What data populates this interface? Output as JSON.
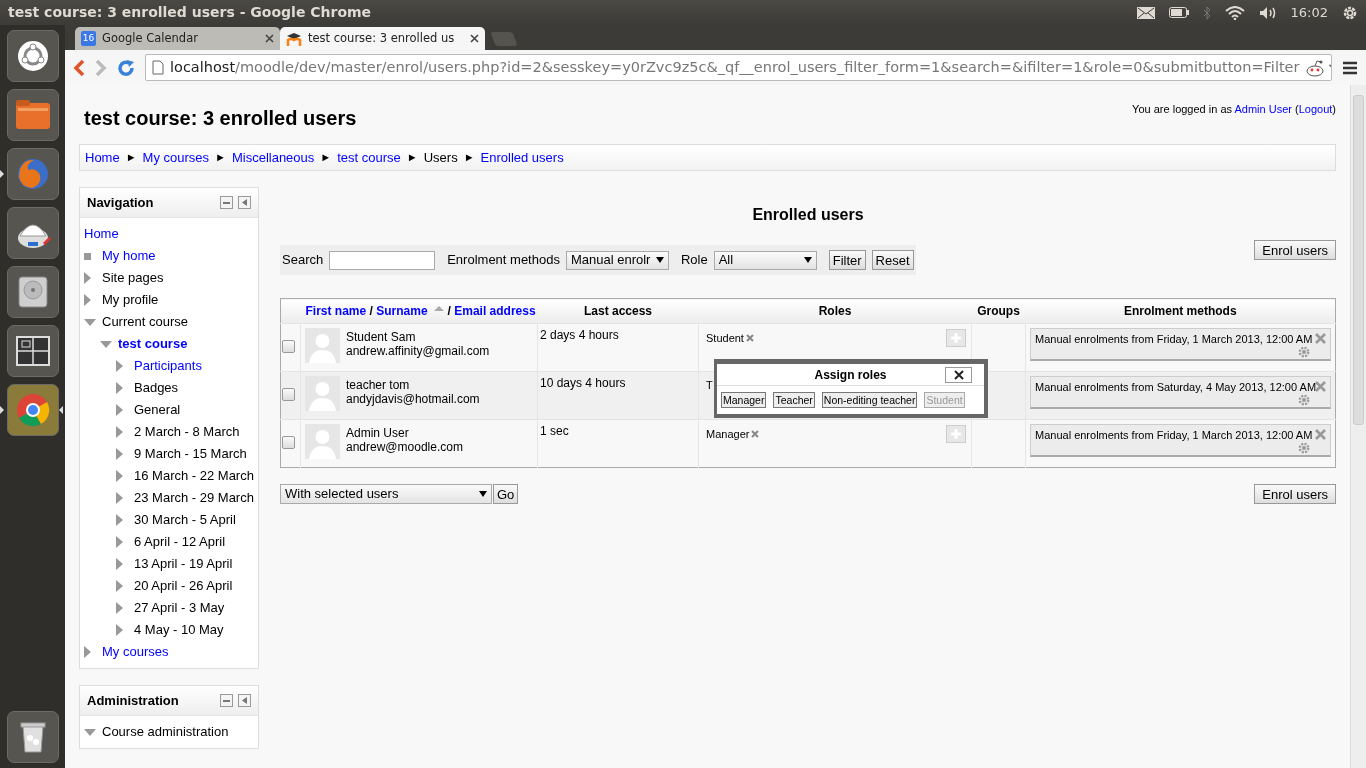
{
  "window": {
    "title": "test course: 3 enrolled users - Google Chrome"
  },
  "tray": {
    "clock": "16:02"
  },
  "launcher": [
    {
      "kind": "ubuntu",
      "running": false,
      "focused": false
    },
    {
      "kind": "files",
      "running": false,
      "focused": false
    },
    {
      "kind": "firefox",
      "running": true,
      "focused": false
    },
    {
      "kind": "app",
      "running": false,
      "focused": false
    },
    {
      "kind": "disk",
      "running": false,
      "focused": false
    },
    {
      "kind": "workspaces",
      "running": false,
      "focused": false
    },
    {
      "kind": "chrome",
      "running": true,
      "focused": true
    },
    {
      "kind": "trash",
      "running": false,
      "focused": false
    }
  ],
  "tabs": [
    {
      "title": "Google Calendar",
      "kind": "calendar",
      "icon_text": "16",
      "selected": false
    },
    {
      "title": "test course: 3 enrolled us",
      "kind": "moodle",
      "selected": true
    }
  ],
  "address": {
    "host": "localhost",
    "path": "/moodle/dev/master/enrol/users.php?id=2&sesskey=y0rZvc9z5c&_qf__enrol_users_filter_form=1&search=&ifilter=1&role=0&submitbutton=Filter"
  },
  "page": {
    "heading": "test course: 3 enrolled users",
    "login": {
      "before": "You are logged in as ",
      "user": "Admin User",
      "between": " (",
      "logout": "Logout",
      "after": ")"
    },
    "breadcrumb": [
      {
        "label": "Home",
        "link": true,
        "sep": "►"
      },
      {
        "label": "My courses",
        "link": true,
        "sep": "►"
      },
      {
        "label": "Miscellaneous",
        "link": true,
        "sep": "►"
      },
      {
        "label": "test course",
        "link": true,
        "sep": "►"
      },
      {
        "label": "Users",
        "link": false,
        "sep": "►"
      },
      {
        "label": "Enrolled users",
        "link": true
      }
    ]
  },
  "navigation": {
    "title": "Navigation",
    "items": [
      {
        "label": "Home",
        "kind": "plain",
        "link": true,
        "selected": false
      },
      {
        "label": "My home",
        "kind": "leaf",
        "link": true,
        "selected": false
      },
      {
        "label": "Site pages",
        "kind": "collapsed",
        "link": false,
        "selected": false
      },
      {
        "label": "My profile",
        "kind": "collapsed",
        "link": false,
        "selected": false
      },
      {
        "label": "Current course",
        "kind": "expanded",
        "link": false,
        "selected": false,
        "children": [
          {
            "label": "test course",
            "kind": "expanded",
            "link": true,
            "selected": true,
            "children": [
              {
                "label": "Participants",
                "kind": "collapsed",
                "link": true,
                "selected": false
              },
              {
                "label": "Badges",
                "kind": "collapsed",
                "link": false,
                "selected": false
              },
              {
                "label": "General",
                "kind": "collapsed",
                "link": false,
                "selected": false
              },
              {
                "label": "2 March - 8 March",
                "kind": "collapsed",
                "link": false,
                "selected": false
              },
              {
                "label": "9 March - 15 March",
                "kind": "collapsed",
                "link": false,
                "selected": false
              },
              {
                "label": "16 March - 22 March",
                "kind": "collapsed",
                "link": false,
                "selected": false
              },
              {
                "label": "23 March - 29 March",
                "kind": "collapsed",
                "link": false,
                "selected": false
              },
              {
                "label": "30 March - 5 April",
                "kind": "collapsed",
                "link": false,
                "selected": false
              },
              {
                "label": "6 April - 12 April",
                "kind": "collapsed",
                "link": false,
                "selected": false
              },
              {
                "label": "13 April - 19 April",
                "kind": "collapsed",
                "link": false,
                "selected": false
              },
              {
                "label": "20 April - 26 April",
                "kind": "collapsed",
                "link": false,
                "selected": false
              },
              {
                "label": "27 April - 3 May",
                "kind": "collapsed",
                "link": false,
                "selected": false
              },
              {
                "label": "4 May - 10 May",
                "kind": "collapsed",
                "link": false,
                "selected": false
              }
            ]
          }
        ]
      },
      {
        "label": "My courses",
        "kind": "collapsed",
        "link": true,
        "selected": false
      }
    ]
  },
  "administration": {
    "title": "Administration",
    "items": [
      {
        "label": "Course administration",
        "kind": "expanded",
        "link": false,
        "selected": false
      }
    ]
  },
  "main": {
    "heading": "Enrolled users",
    "enrol_button": "Enrol users",
    "filter": {
      "search_label": "Search",
      "methods_label": "Enrolment methods",
      "methods_value": "Manual enrolr",
      "role_label": "Role",
      "role_value": "All",
      "filter_button": "Filter",
      "reset_button": "Reset"
    },
    "table": {
      "user_column": {
        "first_name": "First name",
        "sep1": "/",
        "surname": "Surname",
        "sorted": true,
        "sep2": "/",
        "email": "Email address"
      },
      "columns": [
        "Last access",
        "Roles",
        "Groups",
        "Enrolment methods"
      ],
      "rows": [
        {
          "checked": false,
          "name": "Student Sam",
          "email": "andrew.affinity@gmail.com",
          "last_access": "2 days 4 hours",
          "roles": [
            {
              "label": "Student",
              "removable": true
            }
          ],
          "add_role": true,
          "enrolments": [
            "Manual enrolments from Friday, 1 March 2013, 12:00 AM"
          ]
        },
        {
          "checked": false,
          "name": "teacher tom",
          "email": "andyjdavis@hotmail.com",
          "last_access": "10 days 4 hours",
          "roles": [
            {
              "label": "T",
              "removable": false
            }
          ],
          "add_role": false,
          "enrolments": [
            "Manual enrolments from Saturday, 4 May 2013, 12:00 AM"
          ]
        },
        {
          "checked": false,
          "name": "Admin User",
          "email": "andrew@moodle.com",
          "last_access": "1 sec",
          "roles": [
            {
              "label": "Manager",
              "removable": true
            }
          ],
          "add_role": true,
          "enrolments": [
            "Manual enrolments from Friday, 1 March 2013, 12:00 AM"
          ]
        }
      ]
    },
    "popup": {
      "title": "Assign roles",
      "buttons": [
        {
          "label": "Manager",
          "disabled": false
        },
        {
          "label": "Teacher",
          "disabled": false
        },
        {
          "label": "Non-editing teacher",
          "disabled": false
        },
        {
          "label": "Student",
          "disabled": true
        }
      ]
    },
    "bulk": {
      "select": "With selected users",
      "go": "Go"
    },
    "enrol_button_bottom": "Enrol users"
  }
}
